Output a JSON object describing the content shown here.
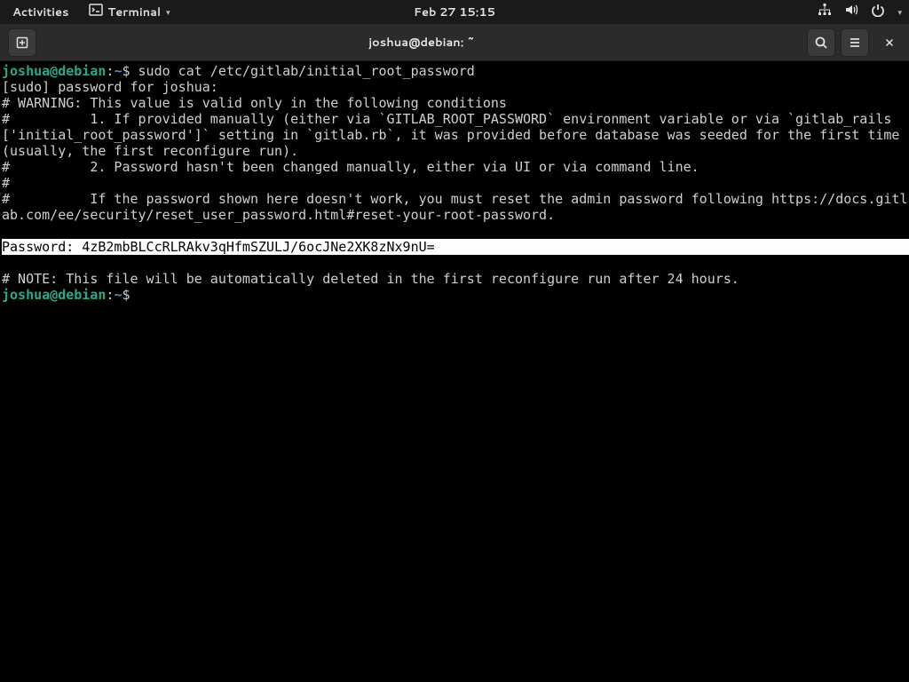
{
  "top_panel": {
    "activities": "Activities",
    "app_name": "Terminal",
    "clock": "Feb 27  15:15"
  },
  "window": {
    "title": "joshua@debian: ~"
  },
  "terminal": {
    "prompt": {
      "userhost": "joshua@debian",
      "colon": ":",
      "path": "~",
      "sigil": "$ "
    },
    "command1": "sudo cat /etc/gitlab/initial_root_password",
    "line_sudo": "[sudo] password for joshua:",
    "line_warn": "# WARNING: This value is valid only in the following conditions",
    "line_c1": "#          1. If provided manually (either via `GITLAB_ROOT_PASSWORD` environment variable or via `gitlab_rails['initial_root_password']` setting in `gitlab.rb`, it was provided before database was seeded for the first time (usually, the first reconfigure run).",
    "line_c2": "#          2. Password hasn't been changed manually, either via UI or via command line.",
    "line_hash": "#",
    "line_reset": "#          If the password shown here doesn't work, you must reset the admin password following https://docs.gitlab.com/ee/security/reset_user_password.html#reset-your-root-password.",
    "password_line": "Password: 4zB2mbBLCcRLRAkv3qHfmSZULJ/6ocJNe2XK8zNx9nU=",
    "note_line": "# NOTE: This file will be automatically deleted in the first reconfigure run after 24 hours."
  }
}
